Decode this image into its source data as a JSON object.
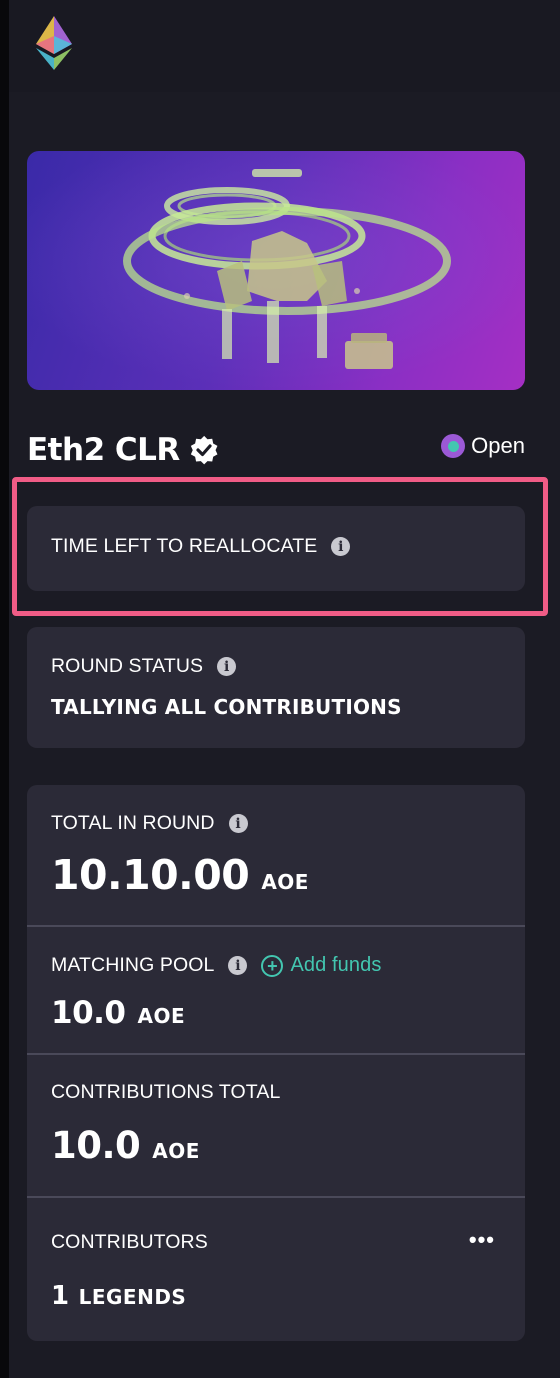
{
  "header": {
    "logo_icon": "ethereum-logo-icon"
  },
  "round": {
    "banner_image": "spaceship-illustration",
    "title": "Eth2 CLR",
    "verified_icon": "verified-badge-icon",
    "status": "Open",
    "status_color": "#43c6b0"
  },
  "time_left": {
    "label": "TIME LEFT TO REALLOCATE",
    "info_icon": "info-icon"
  },
  "round_status": {
    "label": "ROUND STATUS",
    "value": "TALLYING ALL CONTRIBUTIONS"
  },
  "stats": {
    "total_in_round": {
      "label": "TOTAL IN ROUND",
      "value": "10.10.00",
      "unit": "AOE"
    },
    "matching_pool": {
      "label": "MATCHING POOL",
      "add_funds": "Add funds",
      "value": "10.0",
      "unit": "AOE"
    },
    "contributions_total": {
      "label": "CONTRIBUTIONS TOTAL",
      "value": "10.0",
      "unit": "AOE"
    },
    "contributors": {
      "label": "CONTRIBUTORS",
      "value": "1",
      "unit": "LEGENDS",
      "more_label": "•••"
    }
  },
  "colors": {
    "accent_teal": "#43c6b0",
    "highlight_pink": "#f05c86",
    "card_bg": "#2b2a37"
  }
}
